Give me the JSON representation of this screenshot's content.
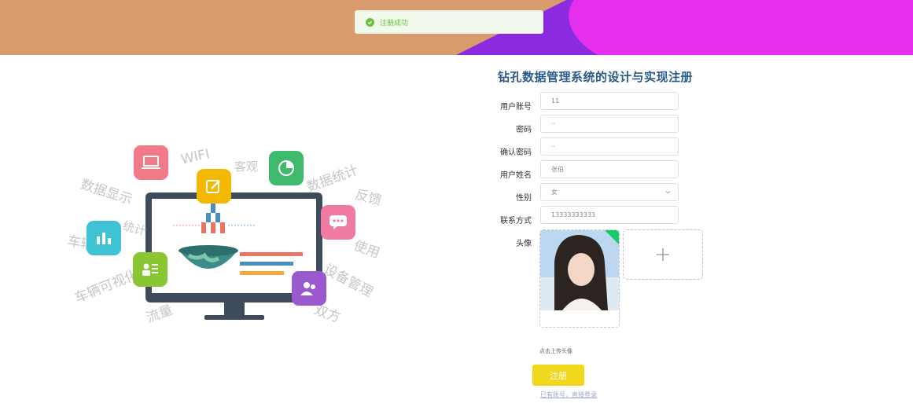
{
  "toast": {
    "message": "注册成功"
  },
  "illustration": {
    "words": [
      "WIFI",
      "客观",
      "数据统计",
      "数据显示",
      "反馈",
      "统计",
      "车辆",
      "使用",
      "车辆可视化",
      "设备管理",
      "流量",
      "双方"
    ]
  },
  "form": {
    "title": "钻孔数据管理系统的设计与实现注册",
    "account": {
      "label": "用户账号",
      "value": "11"
    },
    "password": {
      "label": "密码",
      "value": "··"
    },
    "confirm_password": {
      "label": "确认密码",
      "value": "··"
    },
    "name": {
      "label": "用户姓名",
      "value": "张伯"
    },
    "gender": {
      "label": "性别",
      "value": "女"
    },
    "phone": {
      "label": "联系方式",
      "value": "13333333333"
    },
    "avatar": {
      "label": "头像",
      "upload_hint": "点击上传头像"
    },
    "register_label": "注册",
    "login_link": "已有账号，直接登录"
  },
  "colors": {
    "banner": "#d99c6e",
    "banner_accent": "#e52fed",
    "banner_purple": "#8a2be2",
    "success": "#67c23a",
    "title": "#2a5a86",
    "button": "#f1d81c"
  }
}
